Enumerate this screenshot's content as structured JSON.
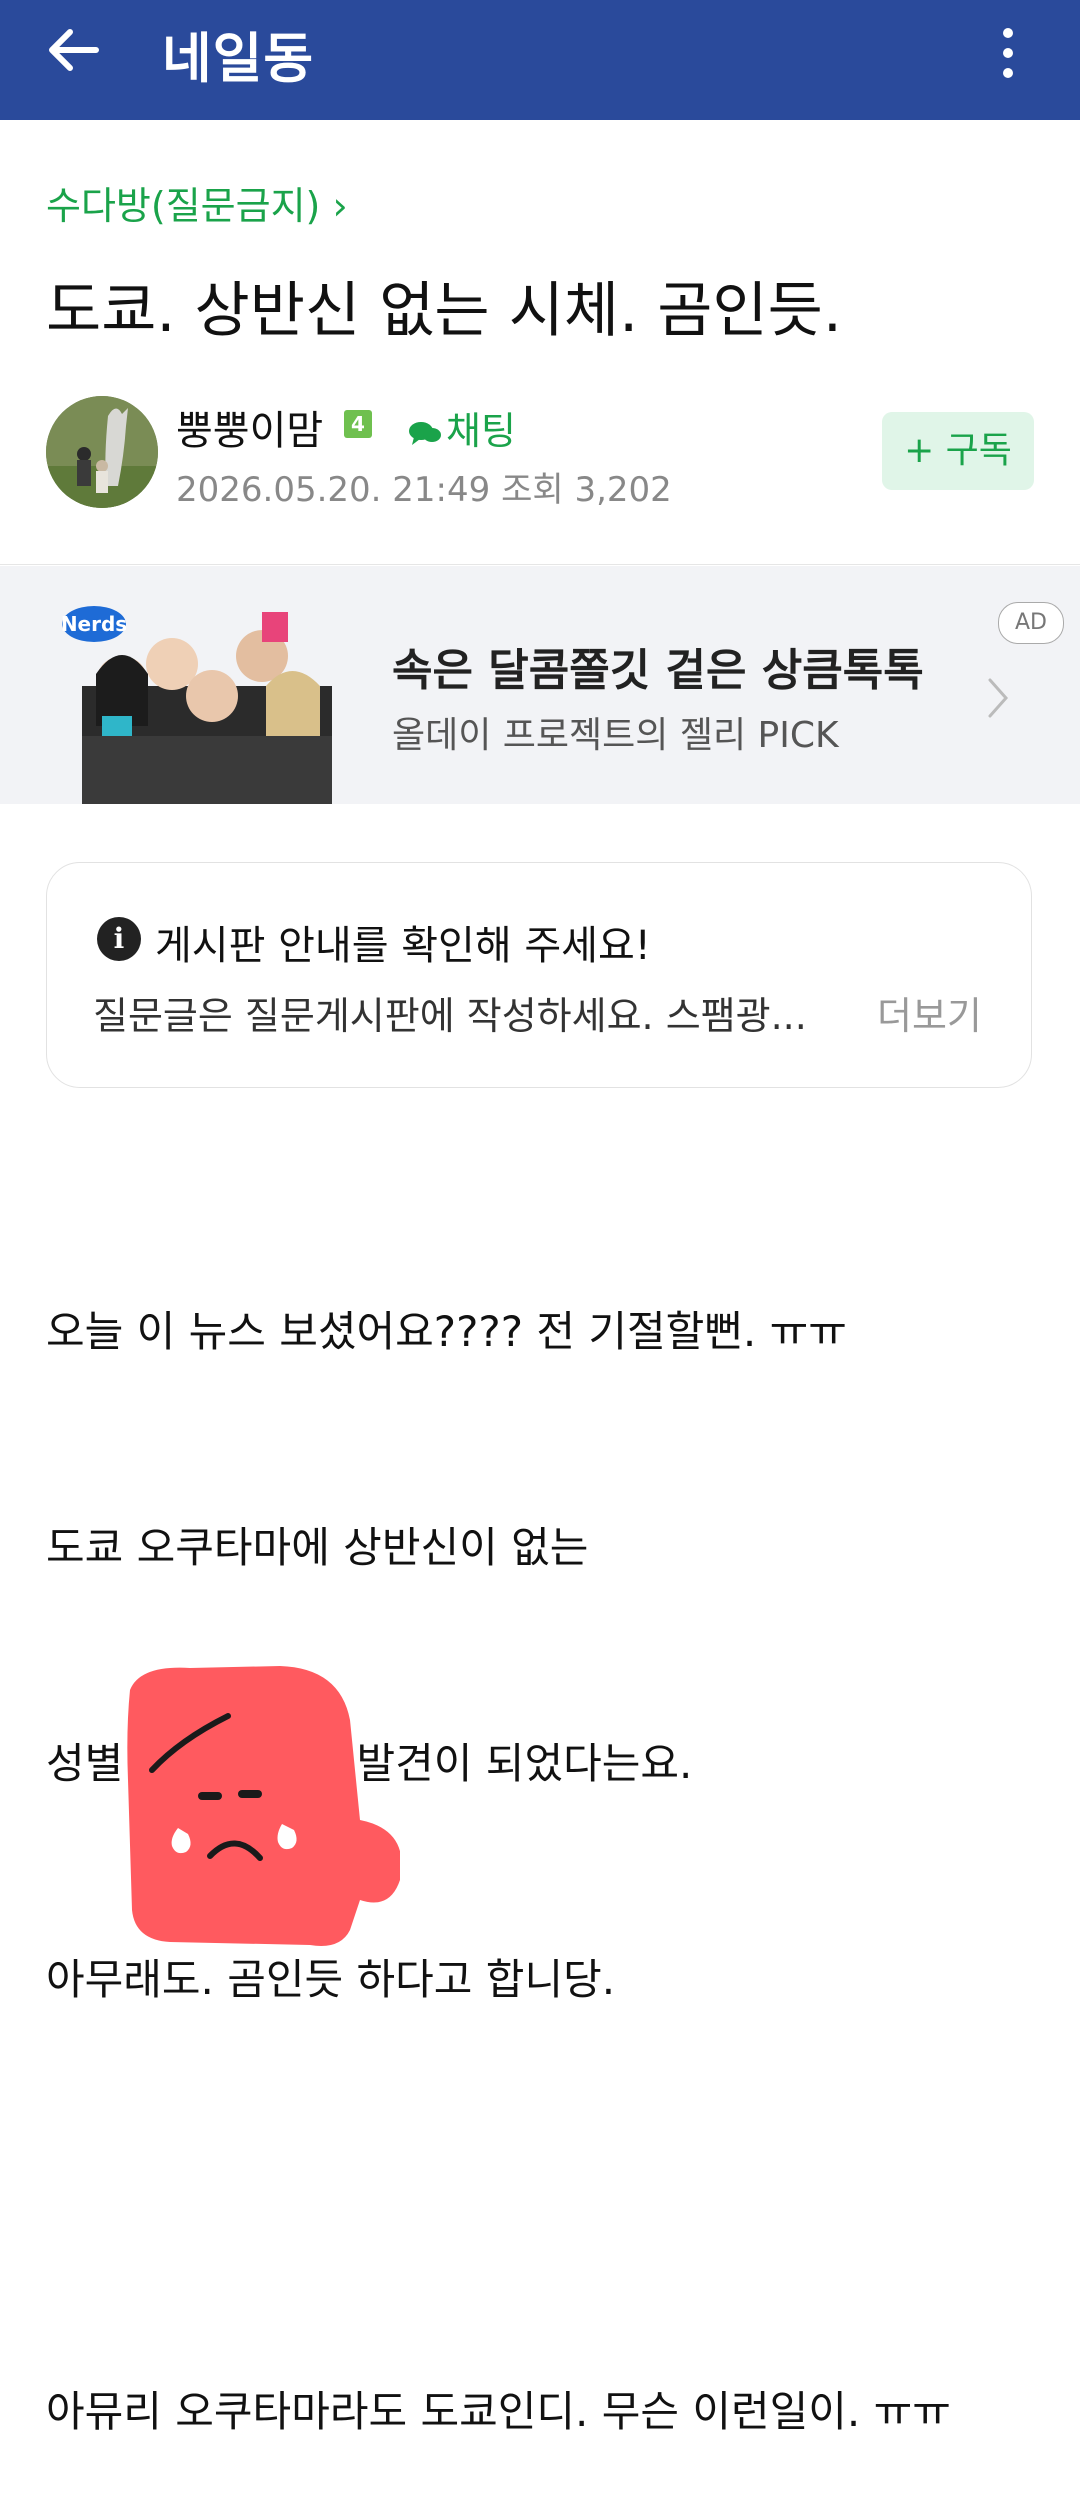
{
  "topbar": {
    "title": "네일동"
  },
  "post": {
    "category": "수다방(질문금지) ›",
    "title": "도쿄. 상반신 없는 시체. 곰인듯.",
    "author": "뿡뿡이맘",
    "level": "4",
    "chat_label": "채팅",
    "meta": "2026.05.20. 21:49  조회 3,202",
    "subscribe_label": "+ 구독"
  },
  "ad": {
    "headline": "속은 달콤쫄깃 겉은 상큼톡톡",
    "sub": "올데이 프로젝트의 젤리 PICK",
    "badge": "AD",
    "brand": "Nerds"
  },
  "notice": {
    "title": "게시판 안내를 확인해 주세요!",
    "text": "질문글은 질문게시판에 작성하세요. 스팸광...",
    "more": "더보기"
  },
  "body": {
    "lines": [
      "오늘 이 뉴스 보셨어요???? 전 기절할뻔. ㅠㅠ",
      "도쿄 오쿠타마에 상반신이 없는",
      "성별 불명의 시체 발견이 되었다는요.",
      "아무래도. 곰인듯 하다고 합니당.",
      "",
      "아뮤리 오쿠타마라도 도쿄인디. 무슨 이런일이. ㅠㅠ"
    ]
  },
  "colors": {
    "topbar": "#2a4a9b",
    "accent_green": "#1aa34a",
    "sticker": "#ff5a5f"
  }
}
